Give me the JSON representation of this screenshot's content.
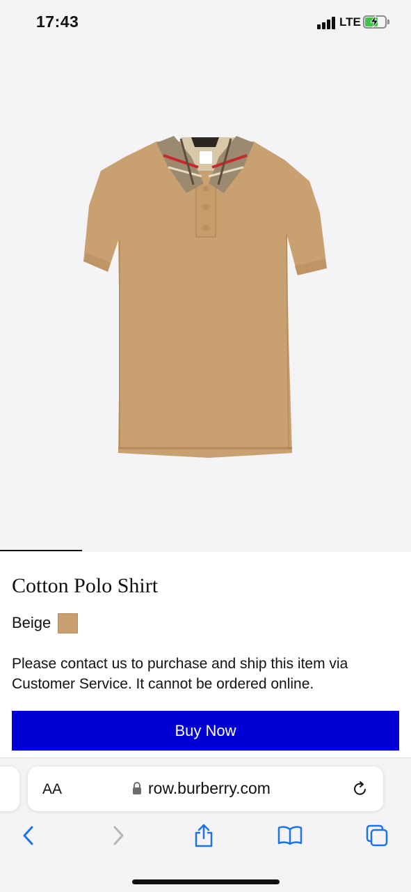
{
  "status_bar": {
    "time": "17:43",
    "network": "LTE",
    "battery_level": 0.65,
    "icons": [
      "cellular-signal-icon",
      "battery-charging-icon"
    ]
  },
  "product": {
    "image_alt": "Cotton Polo Shirt image",
    "image_carousel_progress": 0.2,
    "title": "Cotton Polo Shirt",
    "color_label": "Beige",
    "color_swatch": "#c9a070",
    "notice": "Please contact us to purchase and ship this item via Customer Service. It cannot be ordered online.",
    "buy_button_label": "Buy Now",
    "buy_button_color": "#0000d4"
  },
  "browser": {
    "text_size_label": "AA",
    "url": "row.burberry.com",
    "toolbar_icons": [
      "back-icon",
      "forward-icon",
      "share-icon",
      "bookmarks-icon",
      "tabs-icon"
    ]
  }
}
